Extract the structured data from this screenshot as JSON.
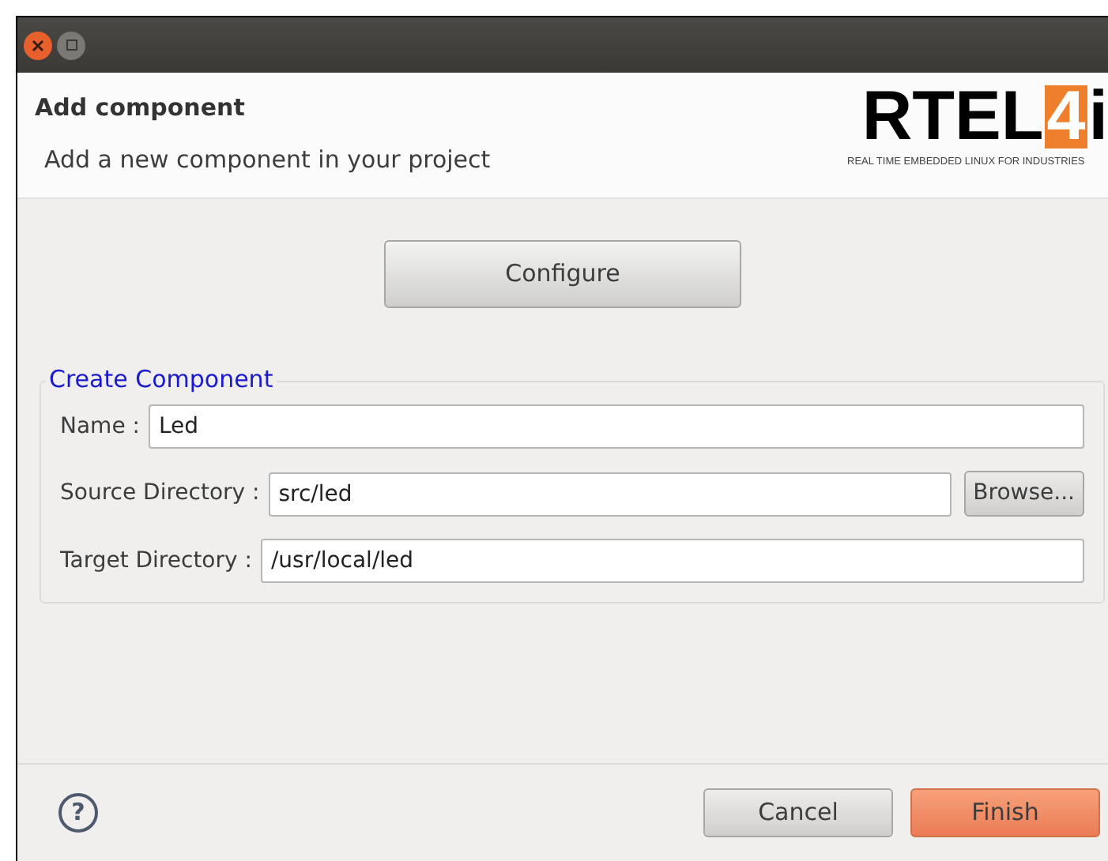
{
  "header": {
    "title": "Add component",
    "subtitle": "Add a new component in your project",
    "logo": {
      "letters": "RTEL",
      "mark": "4",
      "tail": "i",
      "tagline": "REAL TIME EMBEDDED LINUX FOR INDUSTRIES"
    }
  },
  "configure_button": "Configure",
  "group": {
    "title": "Create Component",
    "fields": [
      {
        "label": "Name :",
        "value": "Led"
      },
      {
        "label": "Source Directory :",
        "value": "src/led",
        "button": "Browse..."
      },
      {
        "label": "Target Directory :",
        "value": "/usr/local/led"
      }
    ]
  },
  "footer": {
    "help": "?",
    "buttons": [
      {
        "label": "Cancel",
        "kind": "normal"
      },
      {
        "label": "Finish",
        "kind": "default"
      }
    ]
  }
}
